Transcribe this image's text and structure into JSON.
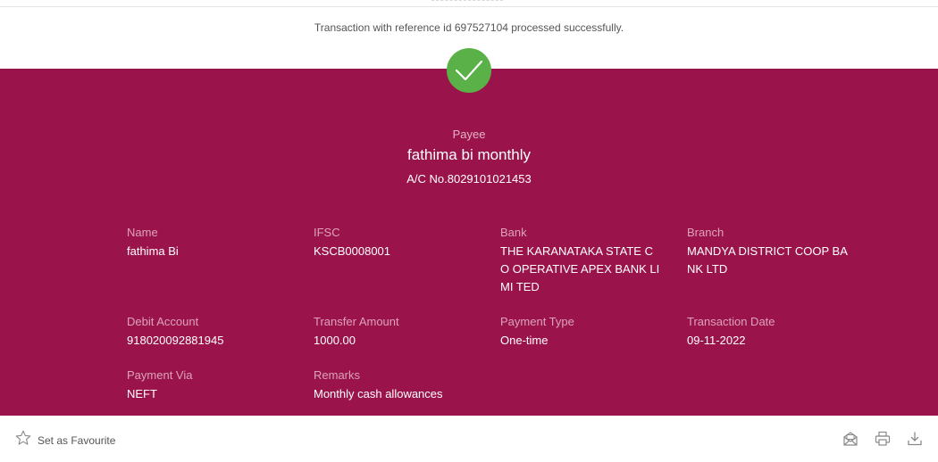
{
  "message": "Transaction with reference id 697527104 processed successfully.",
  "payee": {
    "label": "Payee",
    "name": "fathima bi monthly",
    "account": "A/C No.8029101021453"
  },
  "details": {
    "name": {
      "label": "Name",
      "value": "fathima Bi"
    },
    "ifsc": {
      "label": "IFSC",
      "value": "KSCB0008001"
    },
    "bank": {
      "label": "Bank",
      "value": "THE KARANATAKA STATE CO OPERATIVE APEX BANK LIMI TED"
    },
    "branch": {
      "label": "Branch",
      "value": "MANDYA DISTRICT COOP BA NK LTD"
    },
    "debit_account": {
      "label": "Debit Account",
      "value": "918020092881945"
    },
    "transfer_amount": {
      "label": "Transfer Amount",
      "value": "1000.00"
    },
    "payment_type": {
      "label": "Payment Type",
      "value": "One-time"
    },
    "transaction_date": {
      "label": "Transaction Date",
      "value": "09-11-2022"
    },
    "payment_via": {
      "label": "Payment Via",
      "value": "NEFT"
    },
    "remarks": {
      "label": "Remarks",
      "value": "Monthly cash allowances"
    }
  },
  "footer": {
    "favourite_label": "Set as Favourite",
    "icons": [
      "star-icon",
      "mail-icon",
      "print-icon",
      "download-icon"
    ]
  },
  "colors": {
    "panel": "#9a144b",
    "success": "#59b147"
  }
}
